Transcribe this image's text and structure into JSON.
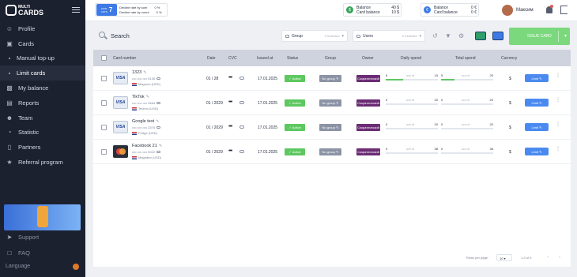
{
  "brand": {
    "small": "MULTI",
    "main": "CARDS"
  },
  "sidebar": {
    "items": [
      {
        "label": "Profile",
        "icon": "user-icon"
      },
      {
        "label": "Cards",
        "icon": "card-icon"
      },
      {
        "label": "Manual top-up",
        "sub": true
      },
      {
        "label": "Limit cards",
        "sub": true,
        "active": true
      },
      {
        "label": "My balance",
        "icon": "wallet-icon"
      },
      {
        "label": "Reports",
        "icon": "chart-icon"
      },
      {
        "label": "Team",
        "icon": "team-icon"
      },
      {
        "label": "Statistic",
        "icon": "statistic-icon"
      },
      {
        "label": "Partners",
        "icon": "partners-icon"
      },
      {
        "label": "Referral program",
        "icon": "referral-icon"
      }
    ],
    "support": "Support",
    "faq": "FAQ",
    "language": "Language"
  },
  "header": {
    "limit_badge_top": "LIMIT",
    "limit_badge_sub": "CNTS",
    "limit_number": "7",
    "decline_sum_label": "Decline rate by sum",
    "decline_sum_value": "0 %",
    "decline_count_label": "Decline rate by count",
    "decline_count_value": "0 %",
    "usd": {
      "balance_label": "Balance",
      "balance_value": "40 $",
      "card_label": "Card balance",
      "card_value": "10 $"
    },
    "eur": {
      "balance_label": "Balance",
      "balance_value": "0 €",
      "card_label": "Card balance",
      "card_value": "0 €"
    },
    "username": "Максим"
  },
  "toolbar": {
    "search_placeholder": "Search",
    "group_label": "Group",
    "group_count": "0 Selected",
    "users_label": "Users",
    "users_count": "0 Selected",
    "issue_button": "ISSUE CARD"
  },
  "table": {
    "columns": [
      "Card number",
      "Date",
      "CVC",
      "Issued at",
      "Status",
      "Group",
      "Owner",
      "Daily spend",
      "Total spend",
      "Currency"
    ],
    "rows": [
      {
        "name": "1323",
        "number": "•••• •••• •••• 5135",
        "meta": "Magnum (USD)",
        "brand": "visa",
        "date": "01 / 28",
        "cvc": "•••",
        "issued": "17.01.2025",
        "status": "Active",
        "group": "No group",
        "owner": "Сократический",
        "daily_a": "5",
        "daily_of": "out of",
        "daily_b": "15",
        "daily_fill": 0.33,
        "total_a": "5",
        "total_of": "out of",
        "total_b": "20",
        "total_fill": 0.25,
        "currency": "$",
        "limit_btn": "Limit"
      },
      {
        "name": "TikTok",
        "number": "•••• •••• •••• 3464",
        "meta": "Techno (USD)",
        "brand": "visa",
        "date": "01 / 2029",
        "cvc": "•••",
        "issued": "17.01.2025",
        "status": "Active",
        "group": "No group",
        "owner": "Сократический",
        "daily_a": "0",
        "daily_of": "out of",
        "daily_b": "20",
        "daily_fill": 0,
        "total_a": "0",
        "total_of": "out of",
        "total_b": "20",
        "total_fill": 0,
        "currency": "$",
        "limit_btn": "Limit"
      },
      {
        "name": "Google test",
        "number": "•••• •••• •••• 2370",
        "meta": "Pudge (USD)",
        "brand": "visa",
        "date": "01 / 2029",
        "cvc": "•••",
        "issued": "17.01.2025",
        "status": "Active",
        "group": "No group",
        "owner": "Сократический",
        "daily_a": "0",
        "daily_of": "out of",
        "daily_b": "20",
        "daily_fill": 0,
        "total_a": "0",
        "total_of": "out of",
        "total_b": "20",
        "total_fill": 0,
        "currency": "$",
        "limit_btn": "Limit"
      },
      {
        "name": "Facebook 21",
        "number": "•••• •••• •••• 9022",
        "meta": "Magnator (USD)",
        "brand": "mastercard",
        "date": "01 / 2029",
        "cvc": "•••",
        "issued": "17.01.2025",
        "status": "Active",
        "group": "No group",
        "owner": "Сократический",
        "daily_a": "0",
        "daily_of": "out of",
        "daily_b": "38",
        "daily_fill": 0,
        "total_a": "0",
        "total_of": "out of",
        "total_b": "38",
        "total_fill": 0,
        "currency": "$",
        "limit_btn": "Limit"
      }
    ]
  },
  "footer": {
    "rows_per_page_label": "Rows per page:",
    "rows_per_page_value": "10",
    "range": "1-4 of 4",
    "prev": "‹",
    "next": "›"
  },
  "colors": {
    "sidebar": "#1c2130",
    "accent": "#4a8af0",
    "active": "#5dc860",
    "owner": "#6b2c74",
    "issue": "#7bd87d"
  }
}
